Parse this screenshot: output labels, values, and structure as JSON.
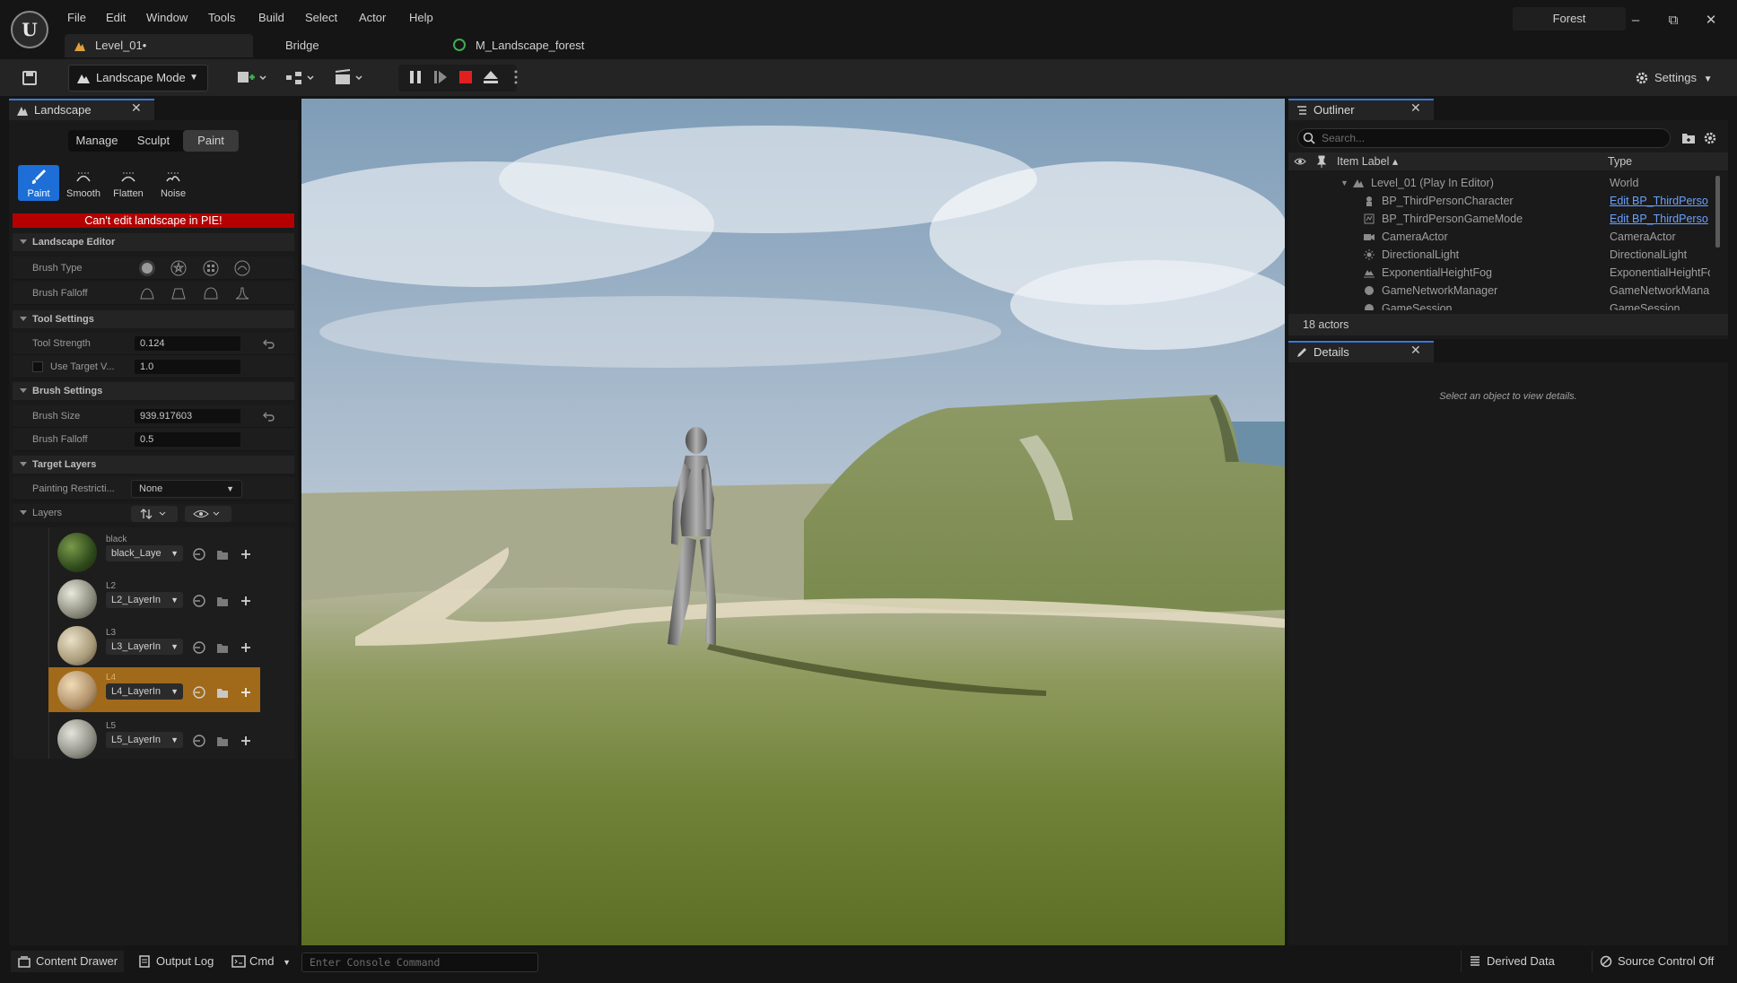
{
  "menu": [
    "File",
    "Edit",
    "Window",
    "Tools",
    "Build",
    "Select",
    "Actor",
    "Help"
  ],
  "project_name": "Forest",
  "doc_tabs": {
    "level": "Level_01•",
    "bridge": "Bridge",
    "material": "M_Landscape_forest"
  },
  "toolbar": {
    "mode": "Landscape Mode",
    "settings": "Settings"
  },
  "landscape_panel": {
    "tab": "Landscape",
    "modes": [
      "Manage",
      "Sculpt",
      "Paint"
    ],
    "tools": [
      "Paint",
      "Smooth",
      "Flatten",
      "Noise"
    ],
    "warning": "Can't edit landscape in PIE!",
    "sections": {
      "editor": "Landscape Editor",
      "tool_settings": "Tool Settings",
      "brush_settings": "Brush Settings",
      "target_layers": "Target Layers",
      "layers": "Layers"
    },
    "props": {
      "brush_type": "Brush Type",
      "brush_falloff_type": "Brush Falloff",
      "tool_strength_label": "Tool Strength",
      "tool_strength": "0.124",
      "use_target_label": "Use Target V...",
      "use_target": "1.0",
      "brush_size_label": "Brush Size",
      "brush_size": "939.917603",
      "brush_falloff_label": "Brush Falloff",
      "brush_falloff": "0.5",
      "painting_label": "Painting Restricti...",
      "painting_value": "None"
    },
    "layers": [
      {
        "name": "black",
        "info": "black_Laye"
      },
      {
        "name": "L2",
        "info": "L2_LayerIn"
      },
      {
        "name": "L3",
        "info": "L3_LayerIn"
      },
      {
        "name": "L4",
        "info": "L4_LayerIn"
      },
      {
        "name": "L5",
        "info": "L5_LayerIn"
      }
    ],
    "selected_layer": "L4"
  },
  "outliner": {
    "tab": "Outliner",
    "search_placeholder": "Search...",
    "col_label": "Item Label ▴",
    "col_type": "Type",
    "rows": [
      {
        "label": "Level_01 (Play In Editor)",
        "type": "World"
      },
      {
        "label": "BP_ThirdPersonCharacter",
        "type": "Edit BP_ThirdPerso"
      },
      {
        "label": "BP_ThirdPersonGameMode",
        "type": "Edit BP_ThirdPerso"
      },
      {
        "label": "CameraActor",
        "type": "CameraActor"
      },
      {
        "label": "DirectionalLight",
        "type": "DirectionalLight"
      },
      {
        "label": "ExponentialHeightFog",
        "type": "ExponentialHeightFo"
      },
      {
        "label": "GameNetworkManager",
        "type": "GameNetworkMana"
      },
      {
        "label": "GameSession",
        "type": "GameSession"
      }
    ],
    "count": "18 actors"
  },
  "details": {
    "tab": "Details",
    "empty_message": "Select an object to view details."
  },
  "statusbar": {
    "content_drawer": "Content Drawer",
    "output_log": "Output Log",
    "cmd": "Cmd",
    "console_placeholder": "Enter Console Command",
    "derived_data": "Derived Data",
    "source_control": "Source Control Off"
  },
  "colors": {
    "accent": "#1d6ed6",
    "warning": "#b40000",
    "selected_layer": "#a06a1a",
    "link": "#6aa0ff"
  }
}
